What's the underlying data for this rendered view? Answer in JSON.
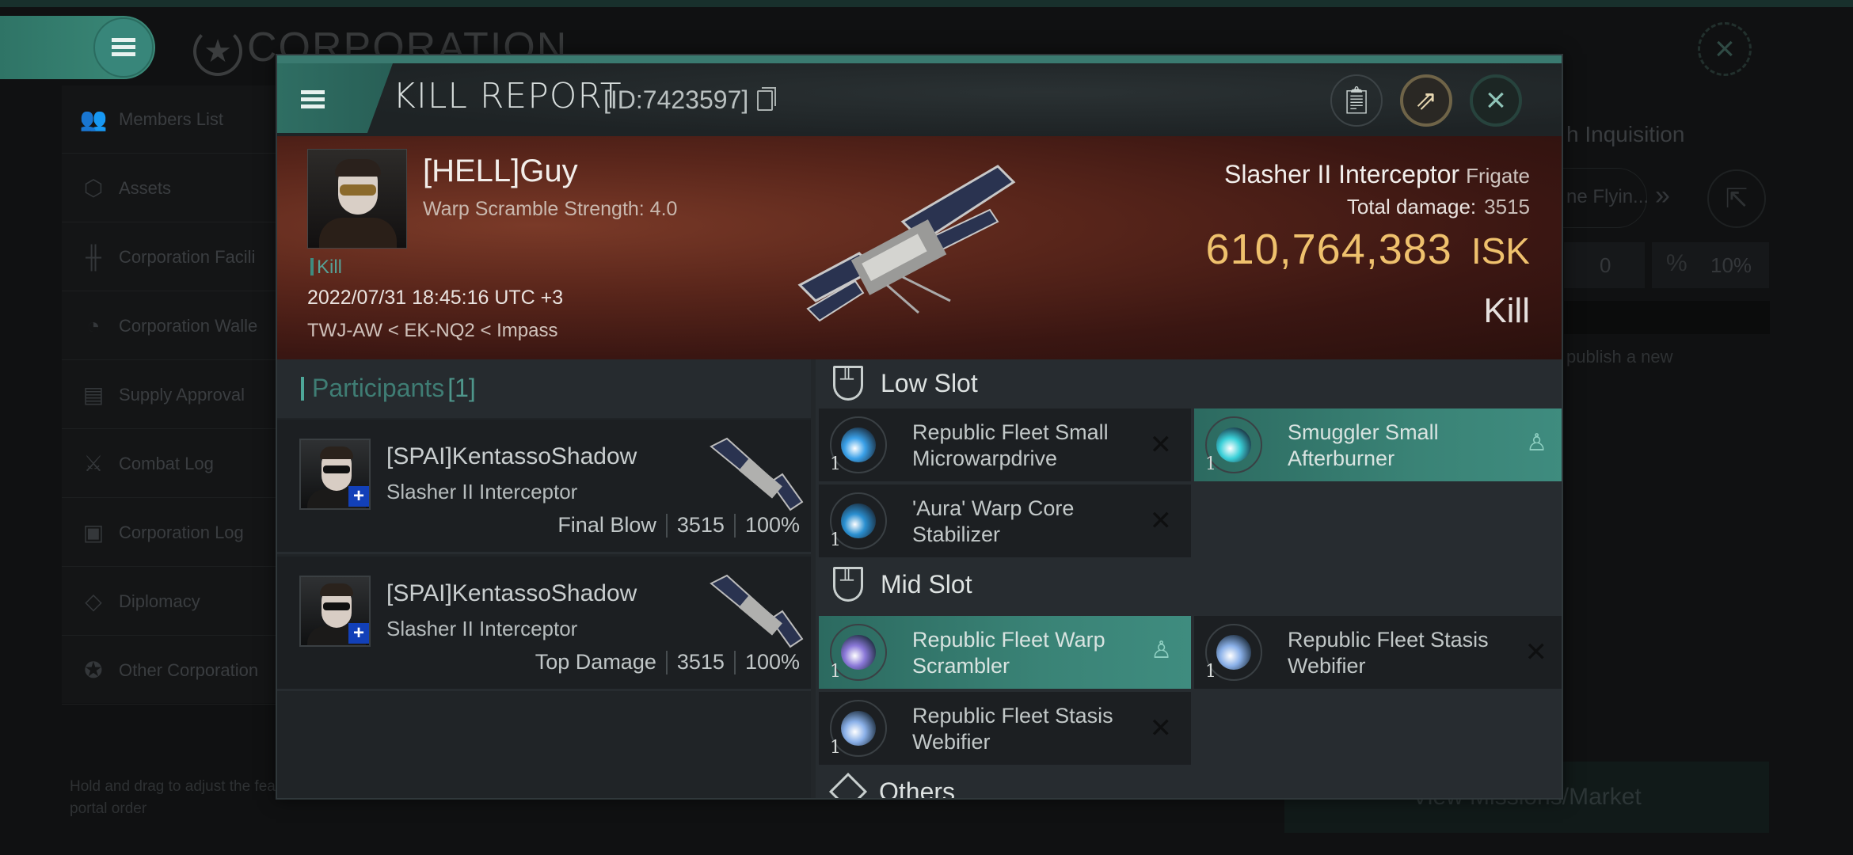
{
  "background_app": {
    "title": "CORPORATION",
    "sidebar": [
      {
        "icon": "members-icon",
        "label": "Members List"
      },
      {
        "icon": "assets-icon",
        "label": "Assets"
      },
      {
        "icon": "facilities-icon",
        "label": "Corporation Facili"
      },
      {
        "icon": "wallet-icon",
        "label": "Corporation Walle"
      },
      {
        "icon": "supply-icon",
        "label": "Supply Approval"
      },
      {
        "icon": "combat-icon",
        "label": "Combat Log"
      },
      {
        "icon": "log-icon",
        "label": "Corporation Log"
      },
      {
        "icon": "diplomacy-icon",
        "label": "Diplomacy"
      },
      {
        "icon": "corporation-icon",
        "label": "Other Corporation"
      }
    ],
    "sidebar_hint": "Hold and drag to adjust the feature portal order",
    "right_panel": {
      "title": "h Inquisition",
      "pill_text": "ne Flyin...",
      "stat_1": "0",
      "stat_2": "10%",
      "publish_text": "publish a new",
      "bottom_button": "View Missions/Market"
    }
  },
  "modal": {
    "title": "KILL REPORT",
    "id_label": "[ID:7423597]",
    "buttons": {
      "clipboard": "clipboard",
      "share": "share",
      "close": "close"
    },
    "victim": {
      "name": "[HELL]Guy",
      "subtitle": "Warp Scramble Strength: 4.0",
      "tag": "Kill",
      "time": "2022/07/31 18:45:16 UTC +3",
      "location": "TWJ-AW < EK-NQ2 < Impass"
    },
    "ship": {
      "name": "Slasher II Interceptor",
      "class": "Frigate",
      "damage_label": "Total damage:",
      "damage_value": "3515",
      "isk_value": "610,764,383",
      "isk_unit": "ISK",
      "result": "Kill"
    },
    "participants": {
      "label": "Participants",
      "count": "[1]",
      "rows": [
        {
          "name": "[SPAI]KentassoShadow",
          "ship": "Slasher II Interceptor",
          "role": "Final Blow",
          "damage": "3515",
          "percent": "100%"
        },
        {
          "name": "[SPAI]KentassoShadow",
          "ship": "Slasher II Interceptor",
          "role": "Top Damage",
          "damage": "3515",
          "percent": "100%"
        }
      ]
    },
    "fitting": {
      "low_slot_label": "Low Slot",
      "mid_slot_label": "Mid Slot",
      "others_label": "Others",
      "low_slot": [
        {
          "name": "Republic Fleet Small Microwarpdrive",
          "qty": "1",
          "status": "destroyed",
          "active": false,
          "color": "#3aa0e8"
        },
        {
          "name": "Smuggler Small Afterburner",
          "qty": "1",
          "status": "dropped",
          "active": true,
          "color": "#3ad0d8"
        },
        {
          "name": "'Aura' Warp Core Stabilizer",
          "qty": "1",
          "status": "destroyed",
          "active": false,
          "color": "#2a8fd0"
        }
      ],
      "mid_slot": [
        {
          "name": "Republic Fleet Warp Scrambler",
          "qty": "1",
          "status": "dropped",
          "active": true,
          "color": "#8a78d8"
        },
        {
          "name": "Republic Fleet Stasis Webifier",
          "qty": "1",
          "status": "destroyed",
          "active": false,
          "color": "#8ab0e8"
        },
        {
          "name": "Republic Fleet Stasis Webifier",
          "qty": "1",
          "status": "destroyed",
          "active": false,
          "color": "#8ab0e8"
        }
      ]
    }
  }
}
